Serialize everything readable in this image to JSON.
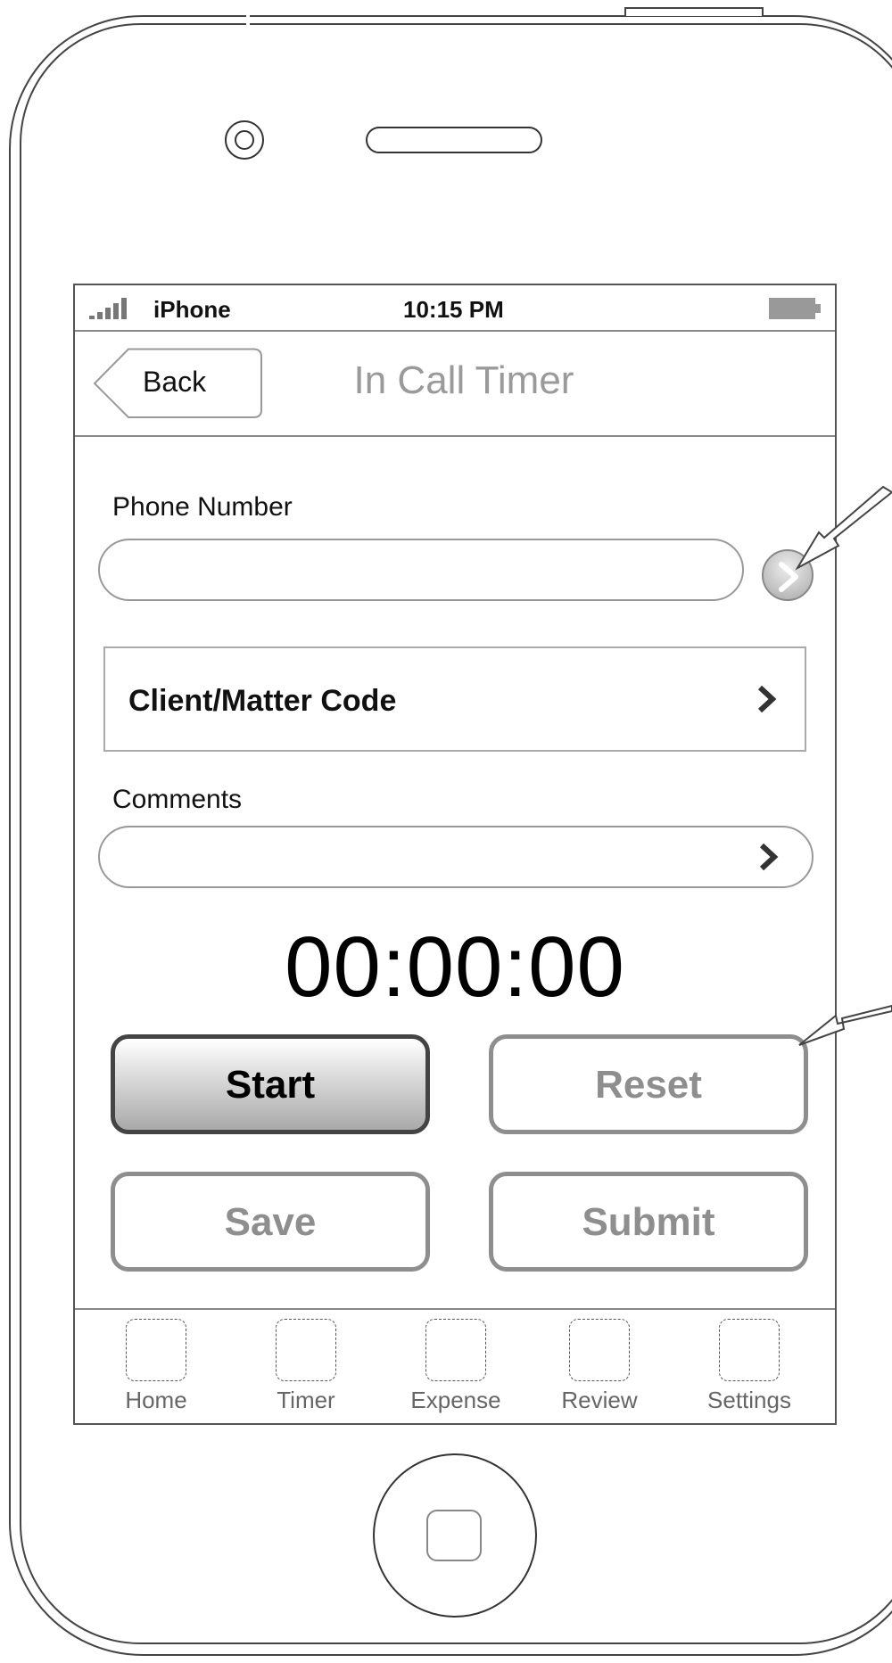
{
  "status_bar": {
    "carrier": "iPhone",
    "time": "10:15 PM",
    "signal_icon": "signal-bars-icon",
    "battery_icon": "battery-icon"
  },
  "nav_bar": {
    "back_label": "Back",
    "title": "In Call Timer"
  },
  "form": {
    "phone_label": "Phone Number",
    "phone_value": "",
    "client_matter_label": "Client/Matter Code",
    "comments_label": "Comments",
    "comments_value": ""
  },
  "timer": {
    "display": "00:00:00"
  },
  "buttons": {
    "start": "Start",
    "reset": "Reset",
    "save": "Save",
    "submit": "Submit"
  },
  "tab_bar": {
    "items": [
      {
        "label": "Home",
        "icon": "placeholder-icon"
      },
      {
        "label": "Timer",
        "icon": "placeholder-icon"
      },
      {
        "label": "Expense",
        "icon": "placeholder-icon"
      },
      {
        "label": "Review",
        "icon": "placeholder-icon"
      },
      {
        "label": "Settings",
        "icon": "placeholder-icon"
      }
    ]
  },
  "colors": {
    "title_gray": "#9a9a9a",
    "disabled_gray": "#8e8e8e",
    "outline": "#444444"
  }
}
